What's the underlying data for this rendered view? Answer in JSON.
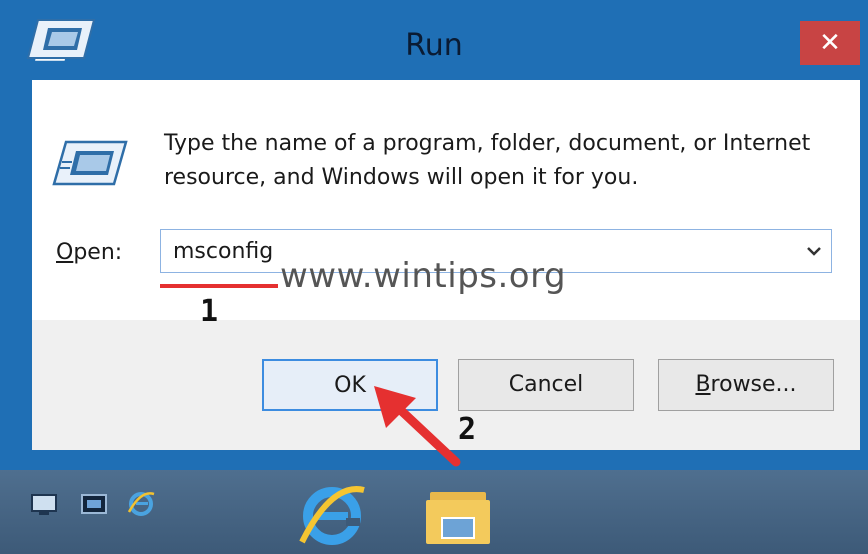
{
  "window": {
    "title": "Run",
    "close_symbol": "✕"
  },
  "dialog": {
    "description": "Type the name of a program, folder, document, or Internet resource, and Windows will open it for you.",
    "open_label_key": "O",
    "open_label_rest": "pen:",
    "open_value": "msconfig",
    "dropdown_symbol": "⌄"
  },
  "buttons": {
    "ok": "OK",
    "cancel": "Cancel",
    "browse_key": "B",
    "browse_rest": "rowse..."
  },
  "annotations": {
    "watermark": "www.wintips.org",
    "step1": "1",
    "step2": "2"
  },
  "taskbar": {
    "quick_launch": [
      "show-desktop-icon",
      "remote-desktop-icon",
      "internet-explorer-icon"
    ],
    "pinned": [
      "internet-explorer-icon",
      "file-explorer-icon",
      "run-icon"
    ],
    "active": "run-icon"
  },
  "colors": {
    "frame": "#1f6fb5",
    "close": "#c84444",
    "highlight": "#e53030",
    "ok_border": "#3c8ce0"
  }
}
